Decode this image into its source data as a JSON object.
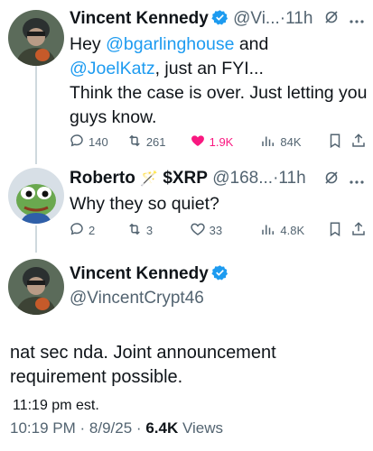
{
  "tweets": [
    {
      "name": "Vincent Kennedy",
      "handle": "@Vi...",
      "sep": "·",
      "time": "11h",
      "body_parts": [
        "Hey ",
        "@bgarlinghouse",
        " and ",
        "@JoelKatz",
        ", just an FYI...",
        "Think the case is over. Just letting you guys know."
      ],
      "replies": "140",
      "retweets": "261",
      "likes": "1.9K",
      "views": "84K"
    },
    {
      "name": "Roberto",
      "name_emoji": "🪄",
      "cashtag": "$XRP",
      "handle": "@168...",
      "sep": "·",
      "time": "11h",
      "body": "Why they so quiet?",
      "replies": "2",
      "retweets": "3",
      "likes": "33",
      "views": "4.8K"
    }
  ],
  "main": {
    "name": "Vincent Kennedy",
    "handle": "@VincentCrypt46",
    "text": "nat sec nda. Joint announcement requirement possible.",
    "extra": "11:19 pm est.",
    "time": "10:19 PM",
    "dot": "·",
    "date": "8/9/25",
    "views_count": "6.4K",
    "views_label": "Views"
  },
  "icons": {
    "verified": "verified-badge-icon",
    "grok": "grok-icon",
    "more": "more-icon",
    "reply": "reply-icon",
    "retweet": "retweet-icon",
    "like": "heart-icon",
    "views": "views-icon",
    "bookmark": "bookmark-icon",
    "share": "share-icon"
  },
  "colors": {
    "accent": "#1d9bf0",
    "like": "#f91880",
    "muted": "#536471",
    "text": "#0f1419"
  }
}
